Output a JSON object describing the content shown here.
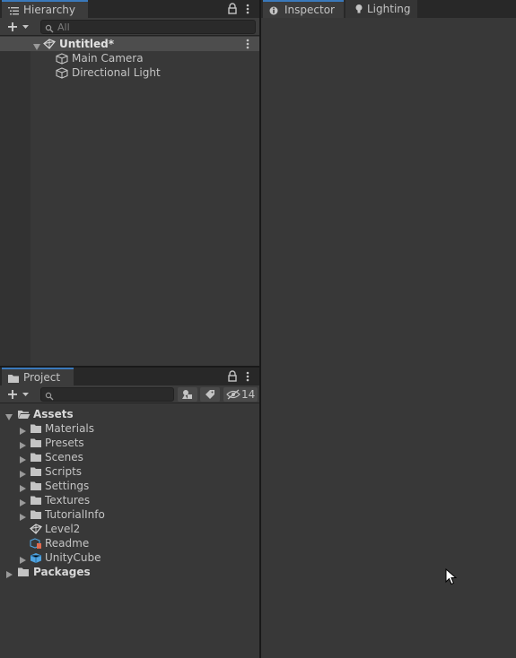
{
  "hierarchy": {
    "tab_label": "Hierarchy",
    "search_placeholder": "All",
    "scene": {
      "name": "Untitled*"
    },
    "items": [
      {
        "label": "Main Camera",
        "icon": "gameobject-cube-icon"
      },
      {
        "label": "Directional Light",
        "icon": "gameobject-cube-icon"
      }
    ]
  },
  "inspector": {
    "tabs": [
      {
        "label": "Inspector",
        "icon": "inspector-icon",
        "active": true
      },
      {
        "label": "Lighting",
        "icon": "lightbulb-icon",
        "active": false
      }
    ]
  },
  "project": {
    "tab_label": "Project",
    "search_placeholder": "",
    "hidden_count": "14",
    "tree": [
      {
        "label": "Assets",
        "type": "folder",
        "bold": true,
        "expanded": true,
        "depth": 0
      },
      {
        "label": "Materials",
        "type": "folder",
        "depth": 1
      },
      {
        "label": "Presets",
        "type": "folder",
        "depth": 1
      },
      {
        "label": "Scenes",
        "type": "folder",
        "depth": 1
      },
      {
        "label": "Scripts",
        "type": "folder",
        "depth": 1
      },
      {
        "label": "Settings",
        "type": "folder",
        "depth": 1
      },
      {
        "label": "Textures",
        "type": "folder",
        "depth": 1
      },
      {
        "label": "TutorialInfo",
        "type": "folder",
        "depth": 1
      },
      {
        "label": "Level2",
        "type": "scene",
        "depth": 1
      },
      {
        "label": "Readme",
        "type": "readme",
        "depth": 1
      },
      {
        "label": "UnityCube",
        "type": "prefab",
        "depth": 1
      },
      {
        "label": "Packages",
        "type": "folder",
        "bold": true,
        "depth": 0
      }
    ]
  },
  "colors": {
    "tab_accent": "#3a79bb",
    "panel_bg": "#383838",
    "selected_row": "#4d4d4d"
  }
}
